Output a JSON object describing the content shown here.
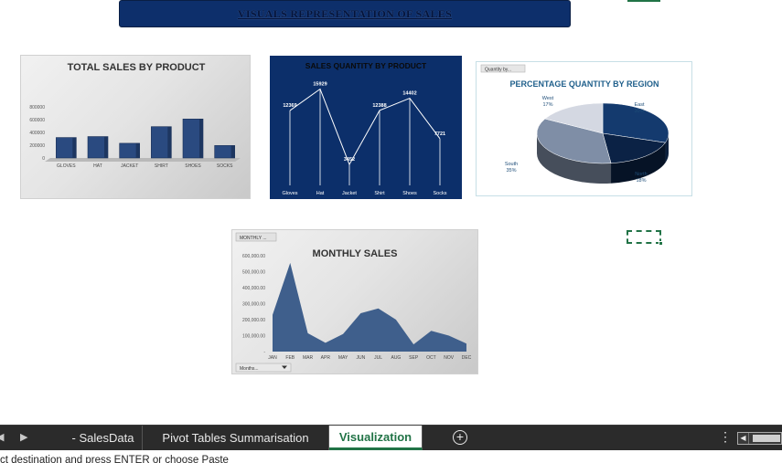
{
  "banner": {
    "title": "VISUALS REPRESENTATION OF SALES"
  },
  "charts": {
    "total_sales": {
      "title": "TOTAL SALES BY PRODUCT",
      "y_ticks": [
        "800000",
        "600000",
        "400000",
        "200000",
        "0"
      ],
      "chart_data": {
        "type": "bar",
        "title": "TOTAL SALES BY PRODUCT",
        "categories": [
          "GLOVES",
          "HAT",
          "JACKET",
          "SHIRT",
          "SHOES",
          "SOCKS"
        ],
        "values": [
          320000,
          335000,
          230000,
          490000,
          610000,
          195000
        ],
        "ylim": [
          0,
          800000
        ]
      }
    },
    "sales_quantity": {
      "title": "SALES QUANTITY BY  PRODUCT",
      "chart_data": {
        "type": "line",
        "title": "SALES QUANTITY BY  PRODUCT",
        "categories": [
          "Gloves",
          "Hat",
          "Jacket",
          "Shirt",
          "Shoes",
          "Socks"
        ],
        "values": [
          12369,
          15929,
          3452,
          12388,
          14402,
          7721
        ],
        "data_labels": [
          "12369",
          "15929",
          "3452",
          "12388",
          "14402",
          "7721"
        ]
      }
    },
    "quantity_region": {
      "title": "PERCENTAGE QUANTITY  BY REGION",
      "filter_button": "Quantity by...",
      "chart_data": {
        "type": "pie",
        "title": "PERCENTAGE QUANTITY  BY REGION",
        "labels": [
          "East",
          "North",
          "South",
          "West"
        ],
        "values": [
          30,
          18,
          35,
          17
        ],
        "data_labels": [
          {
            "name": "East",
            "pct": "30%"
          },
          {
            "name": "North",
            "pct": "18%"
          },
          {
            "name": "South",
            "pct": "35%"
          },
          {
            "name": "West",
            "pct": "17%"
          }
        ],
        "colors": [
          "#143a6e",
          "#0b2245",
          "#7f8ea6",
          "#d4d8e2"
        ]
      }
    },
    "monthly_sales": {
      "title": "MONTHLY SALES",
      "filter_button": "MONTHLY ...",
      "month_dropdown": "Months...",
      "y_ticks": [
        "600,000.00",
        "500,000.00",
        "400,000.00",
        "300,000.00",
        "200,000.00",
        "100,000.00",
        "-"
      ],
      "chart_data": {
        "type": "area",
        "title": "MONTHLY SALES",
        "categories": [
          "JAN",
          "FEB",
          "MAR",
          "APR",
          "MAY",
          "JUN",
          "JUL",
          "AUG",
          "SEP",
          "OCT",
          "NOV",
          "DEC"
        ],
        "values": [
          230000,
          555000,
          115000,
          55000,
          110000,
          240000,
          270000,
          200000,
          45000,
          130000,
          100000,
          50000
        ],
        "ylim": [
          0,
          600000
        ]
      }
    }
  },
  "sheet_tabs": {
    "prev_arrow": "◀",
    "next_arrow": "▶",
    "tabs": [
      {
        "label": "- SalesData",
        "active": false
      },
      {
        "label": "Pivot Tables Summarisation",
        "active": false
      },
      {
        "label": "Visualization",
        "active": true
      }
    ],
    "add_sheet": "+",
    "more": "⋮"
  },
  "status": {
    "message": "ct destination and press ENTER or choose Paste"
  },
  "colors": {
    "accent": "#217346",
    "navy": "#0c2f6a",
    "bar": "#2a4a80"
  }
}
